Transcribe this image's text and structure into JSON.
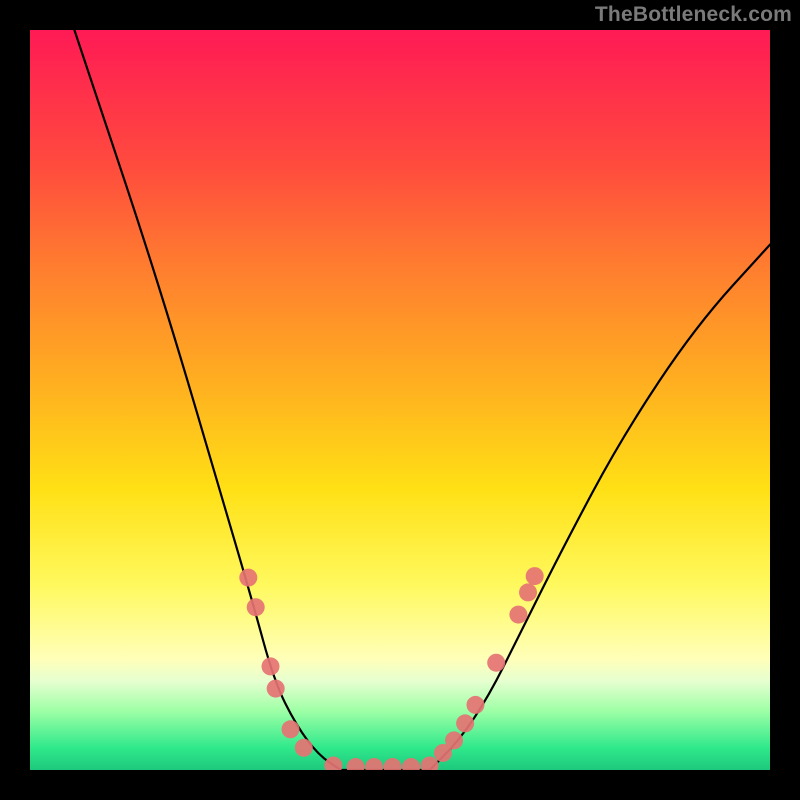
{
  "watermark": "TheBottleneck.com",
  "chart_data": {
    "type": "line",
    "title": "",
    "xlabel": "",
    "ylabel": "",
    "xlim": [
      0,
      100
    ],
    "ylim": [
      0,
      100
    ],
    "grid": false,
    "legend": false,
    "series": [
      {
        "name": "bottleneck-curve-left",
        "x": [
          6,
          10,
          15,
          20,
          25,
          30,
          33,
          36,
          39,
          42
        ],
        "y": [
          100,
          88,
          73,
          57,
          40,
          23,
          12,
          6,
          2,
          0
        ]
      },
      {
        "name": "bottleneck-curve-bottom",
        "x": [
          42,
          45,
          48,
          51,
          54
        ],
        "y": [
          0,
          0,
          0,
          0,
          0
        ]
      },
      {
        "name": "bottleneck-curve-right",
        "x": [
          54,
          58,
          62,
          66,
          72,
          80,
          90,
          100
        ],
        "y": [
          0,
          4,
          10,
          18,
          30,
          45,
          60,
          71
        ]
      }
    ],
    "markers": {
      "name": "highlighted-points",
      "color": "#e57373",
      "radius": 9,
      "points": [
        {
          "x": 29.5,
          "y": 26
        },
        {
          "x": 30.5,
          "y": 22
        },
        {
          "x": 32.5,
          "y": 14
        },
        {
          "x": 33.2,
          "y": 11
        },
        {
          "x": 35.2,
          "y": 5.5
        },
        {
          "x": 37.0,
          "y": 3.0
        },
        {
          "x": 41.0,
          "y": 0.6
        },
        {
          "x": 44.0,
          "y": 0.4
        },
        {
          "x": 46.5,
          "y": 0.4
        },
        {
          "x": 49.0,
          "y": 0.4
        },
        {
          "x": 51.5,
          "y": 0.4
        },
        {
          "x": 54.0,
          "y": 0.6
        },
        {
          "x": 55.8,
          "y": 2.3
        },
        {
          "x": 57.3,
          "y": 4.0
        },
        {
          "x": 58.8,
          "y": 6.3
        },
        {
          "x": 60.2,
          "y": 8.8
        },
        {
          "x": 63.0,
          "y": 14.5
        },
        {
          "x": 66.0,
          "y": 21.0
        },
        {
          "x": 67.3,
          "y": 24.0
        },
        {
          "x": 68.2,
          "y": 26.2
        }
      ]
    }
  }
}
